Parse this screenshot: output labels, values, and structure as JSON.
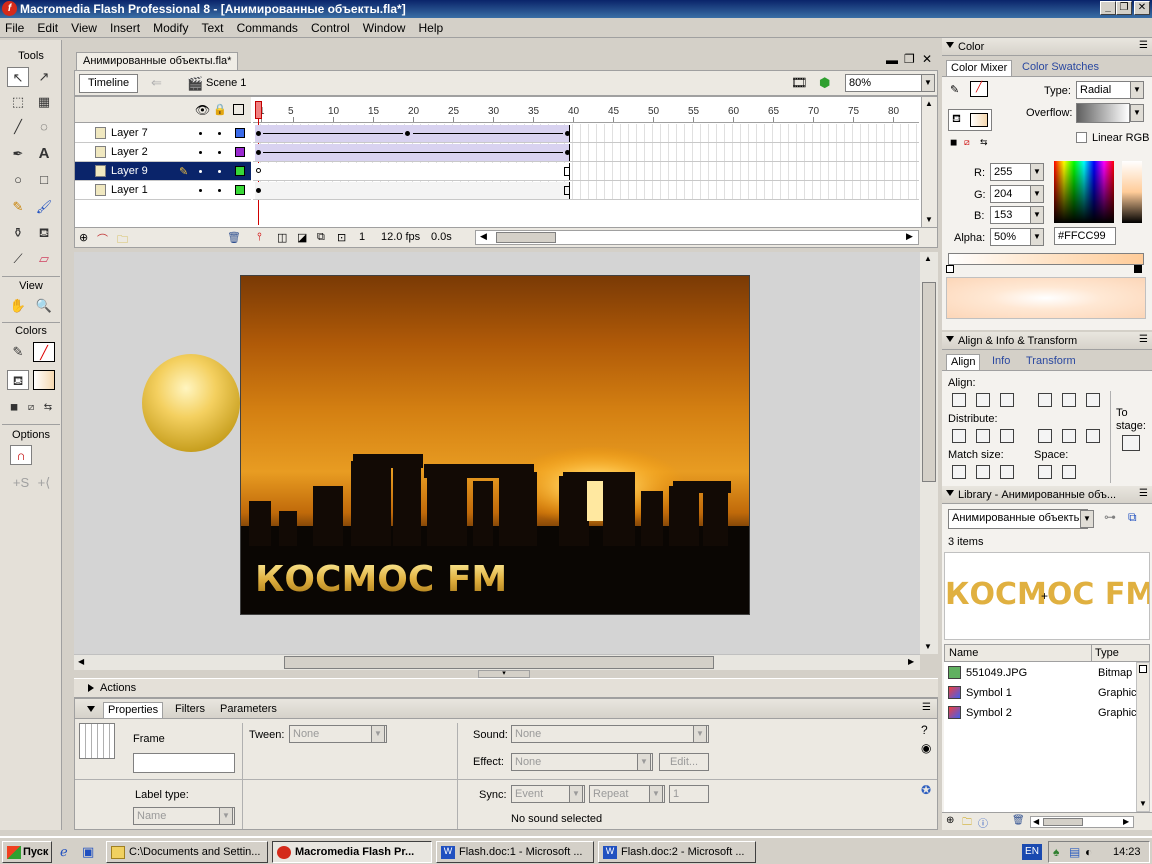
{
  "window": {
    "title": "Macromedia Flash Professional 8 - [Анимированные объекты.fla*]",
    "app_icon": "f",
    "controls": {
      "minimize": "_",
      "restore": "❐",
      "close": "✕"
    }
  },
  "menu": [
    "File",
    "Edit",
    "View",
    "Insert",
    "Modify",
    "Text",
    "Commands",
    "Control",
    "Window",
    "Help"
  ],
  "tools": {
    "header": "Tools",
    "view_header": "View",
    "colors_header": "Colors",
    "options_header": "Options"
  },
  "document": {
    "tab": "Анимированные объекты.fla*",
    "timeline_button": "Timeline",
    "scene": "Scene 1",
    "zoom": "80%"
  },
  "timeline": {
    "ruler": [
      "1",
      "5",
      "10",
      "15",
      "20",
      "25",
      "30",
      "35",
      "40",
      "45",
      "50",
      "55",
      "60",
      "65",
      "70",
      "75",
      "80"
    ],
    "layers": [
      {
        "name": "Layer 7",
        "color": "#3a6ae8",
        "selected": false
      },
      {
        "name": "Layer 2",
        "color": "#9a2ad0",
        "selected": false
      },
      {
        "name": "Layer 9",
        "color": "#38d838",
        "selected": true
      },
      {
        "name": "Layer 1",
        "color": "#38d838",
        "selected": false
      }
    ],
    "current_frame": "1",
    "fps": "12.0 fps",
    "elapsed": "0.0s"
  },
  "stage": {
    "banner_text": "КОСМОС FM"
  },
  "color_panel": {
    "title": "Color",
    "tabs": [
      "Color Mixer",
      "Color Swatches"
    ],
    "type_label": "Type:",
    "type_value": "Radial",
    "overflow_label": "Overflow:",
    "linear_rgb": "Linear RGB",
    "r_label": "R:",
    "r": "255",
    "g_label": "G:",
    "g": "204",
    "b_label": "B:",
    "b": "153",
    "alpha_label": "Alpha:",
    "alpha": "50%",
    "hex": "#FFCC99"
  },
  "align_panel": {
    "title": "Align & Info & Transform",
    "tabs": [
      "Align",
      "Info",
      "Transform"
    ],
    "align_label": "Align:",
    "distribute_label": "Distribute:",
    "match_size_label": "Match size:",
    "space_label": "Space:",
    "to_stage_label": "To stage:"
  },
  "library": {
    "title": "Library - Анимированные объ...",
    "document": "Анимированные объекть",
    "count": "3 items",
    "preview_text": "КОСМОС FM",
    "col_name": "Name",
    "col_type": "Type",
    "items": [
      {
        "name": "551049.JPG",
        "type": "Bitmap"
      },
      {
        "name": "Symbol 1",
        "type": "Graphic"
      },
      {
        "name": "Symbol 2",
        "type": "Graphic"
      }
    ]
  },
  "actions_panel": {
    "title": "Actions"
  },
  "properties": {
    "tabs": [
      "Properties",
      "Filters",
      "Parameters"
    ],
    "frame_label": "Frame",
    "tween_label": "Tween:",
    "tween": "None",
    "sound_label": "Sound:",
    "sound": "None",
    "effect_label": "Effect:",
    "effect": "None",
    "edit_button": "Edit...",
    "label_type_label": "Label type:",
    "label_type": "Name",
    "sync_label": "Sync:",
    "sync": "Event",
    "repeat": "Repeat",
    "repeat_count": "1",
    "no_sound": "No sound selected"
  },
  "taskbar": {
    "start": "Пуск",
    "items": [
      {
        "label": "C:\\Documents and Settin...",
        "active": false
      },
      {
        "label": "Macromedia Flash Pr...",
        "active": true
      },
      {
        "label": "Flash.doc:1 - Microsoft ...",
        "active": false
      },
      {
        "label": "Flash.doc:2 - Microsoft ...",
        "active": false
      }
    ],
    "lang": "EN",
    "clock": "14:23"
  }
}
